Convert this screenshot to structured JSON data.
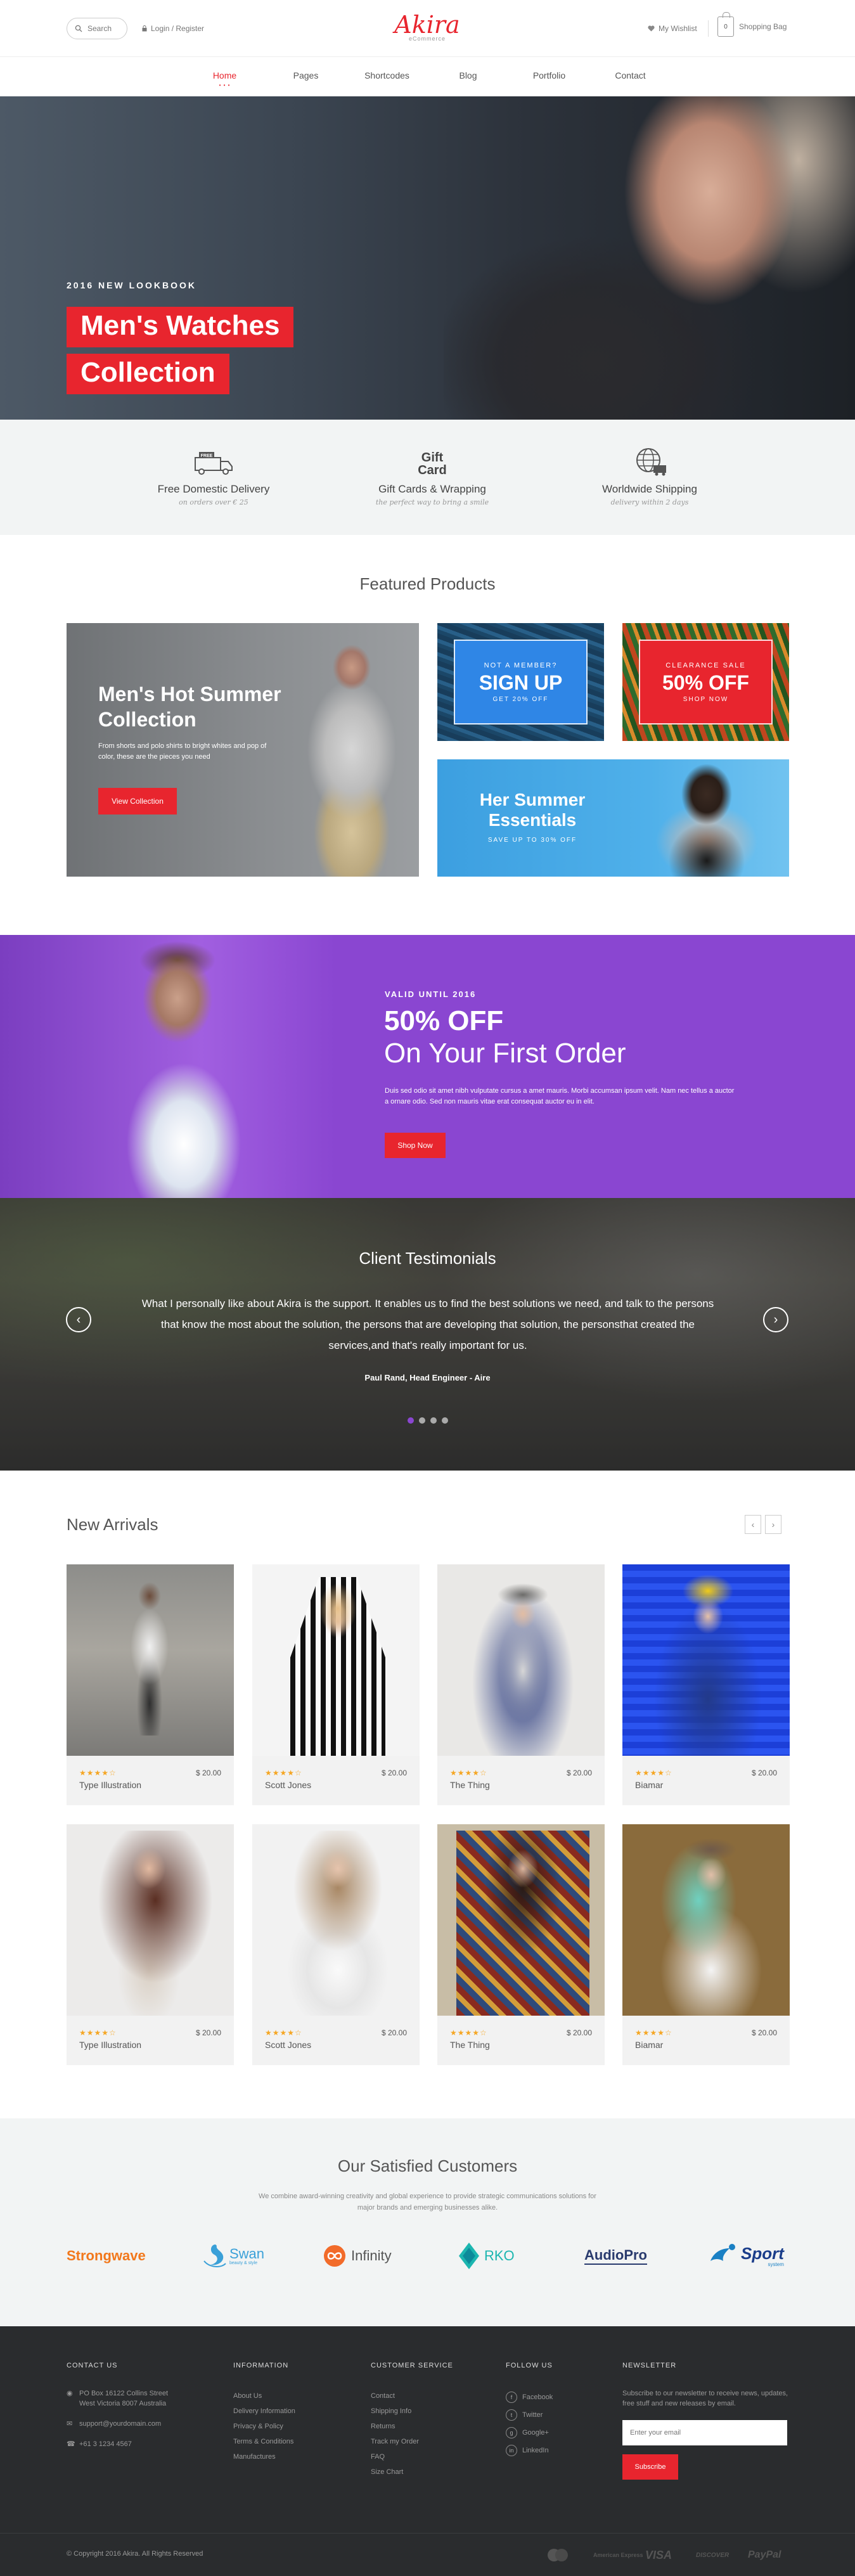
{
  "header": {
    "search_label": "Search",
    "login_label": "Login / Register",
    "logo_text": "Akira",
    "logo_sub": "eCommerce",
    "wishlist_label": "My Wishlist",
    "bag_count": "0",
    "bag_label": "Shopping Bag"
  },
  "nav": [
    "Home",
    "Pages",
    "Shortcodes",
    "Blog",
    "Portfolio",
    "Contact"
  ],
  "hero": {
    "kicker": "2016 NEW LOOKBOOK",
    "line1": "Men's Watches",
    "line2": "Collection"
  },
  "features": [
    {
      "icon_text": "FREE",
      "title": "Free Domestic Delivery",
      "sub": "on orders over € 25"
    },
    {
      "icon_text": "Gift Card",
      "title": "Gift Cards & Wrapping",
      "sub": "the perfect way to bring a smile"
    },
    {
      "icon_text": "",
      "title": "Worldwide Shipping",
      "sub": "delivery within 2 days"
    }
  ],
  "featured": {
    "title": "Featured Products",
    "main": {
      "title": "Men's Hot Summer Collection",
      "text": "From shorts and polo shirts to bright whites and pop of color, these are the pieces you need",
      "button": "View Collection"
    },
    "signup": {
      "kicker": "NOT A MEMBER?",
      "big": "SIGN UP",
      "small": "GET 20% OFF"
    },
    "clearance": {
      "kicker": "CLEARANCE SALE",
      "big": "50% OFF",
      "small": "SHOP NOW"
    },
    "summer": {
      "title": "Her Summer Essentials",
      "sub": "SAVE UP TO 30% OFF"
    }
  },
  "promo": {
    "valid": "VALID UNTIL 2016",
    "big": "50% OFF",
    "sub": "On Your First Order",
    "body": "Duis sed odio sit amet nibh vulputate cursus a amet mauris. Morbi accumsan ipsum velit. Nam nec tellus a auctor a ornare odio. Sed non mauris vitae erat consequat auctor eu in elit.",
    "button": "Shop Now"
  },
  "testimonials": {
    "title": "Client Testimonials",
    "quote": "What I personally like about Akira is the support. It enables us to find the best solutions we need, and talk to the persons that know the most about the solution, the persons that are developing that solution, the personsthat created the services,and that's really important for us.",
    "author": "Paul Rand, Head Engineer - Aire",
    "prev": "‹",
    "next": "›"
  },
  "arrivals": {
    "title": "New Arrivals",
    "prev": "‹",
    "next": "›",
    "products": [
      {
        "name": "Type Illustration",
        "price": "$ 20.00",
        "stars": "★★★★☆"
      },
      {
        "name": "Scott Jones",
        "price": "$ 20.00",
        "stars": "★★★★☆"
      },
      {
        "name": "The Thing",
        "price": "$ 20.00",
        "stars": "★★★★☆"
      },
      {
        "name": "Biamar",
        "price": "$ 20.00",
        "stars": "★★★★☆"
      },
      {
        "name": "Type Illustration",
        "price": "$ 20.00",
        "stars": "★★★★☆"
      },
      {
        "name": "Scott Jones",
        "price": "$ 20.00",
        "stars": "★★★★☆"
      },
      {
        "name": "The Thing",
        "price": "$ 20.00",
        "stars": "★★★★☆"
      },
      {
        "name": "Biamar",
        "price": "$ 20.00",
        "stars": "★★★★☆"
      }
    ]
  },
  "customers": {
    "title": "Our Satisfied Customers",
    "text": "We combine award-winning creativity and global experience to provide strategic communications solutions for major brands and emerging businesses alike.",
    "brands": [
      "Strongwave",
      "Swan",
      "Infinity",
      "RKO",
      "AudioPro",
      "Sport"
    ],
    "brand_sub_swan": "beauty & style",
    "brand_sub_sport": "system"
  },
  "footer": {
    "contact": {
      "heading": "CONTACT US",
      "address_line1": "PO Box 16122 Collins Street",
      "address_line2": "West Victoria 8007 Australia",
      "email": "support@yourdomain.com",
      "phone": "+61 3 1234 4567"
    },
    "information": {
      "heading": "INFORMATION",
      "links": [
        "About Us",
        "Delivery Information",
        "Privacy & Policy",
        "Terms & Conditions",
        "Manufactures"
      ]
    },
    "service": {
      "heading": "CUSTOMER SERVICE",
      "links": [
        "Contact",
        "Shipping Info",
        "Returns",
        "Track my Order",
        "FAQ",
        "Size Chart"
      ]
    },
    "follow": {
      "heading": "FOLLOW US",
      "links": [
        "Facebook",
        "Twitter",
        "Google+",
        "LinkedIn"
      ]
    },
    "newsletter": {
      "heading": "NEWSLETTER",
      "text": "Subscribe to our newsletter to receive news, updates, free stuff and new releases by email.",
      "placeholder": "Enter your email",
      "button": "Subscribe"
    },
    "copyright": "© Copyright 2016 Akira. All Rights Reserved",
    "payments": [
      "MasterCard",
      "American Express",
      "VISA",
      "DISCOVER",
      "PayPal"
    ]
  },
  "colors": {
    "accent": "#e8252e",
    "purple": "#8a46d1",
    "blue": "#2f86e6",
    "footer": "#2a2c2e"
  }
}
